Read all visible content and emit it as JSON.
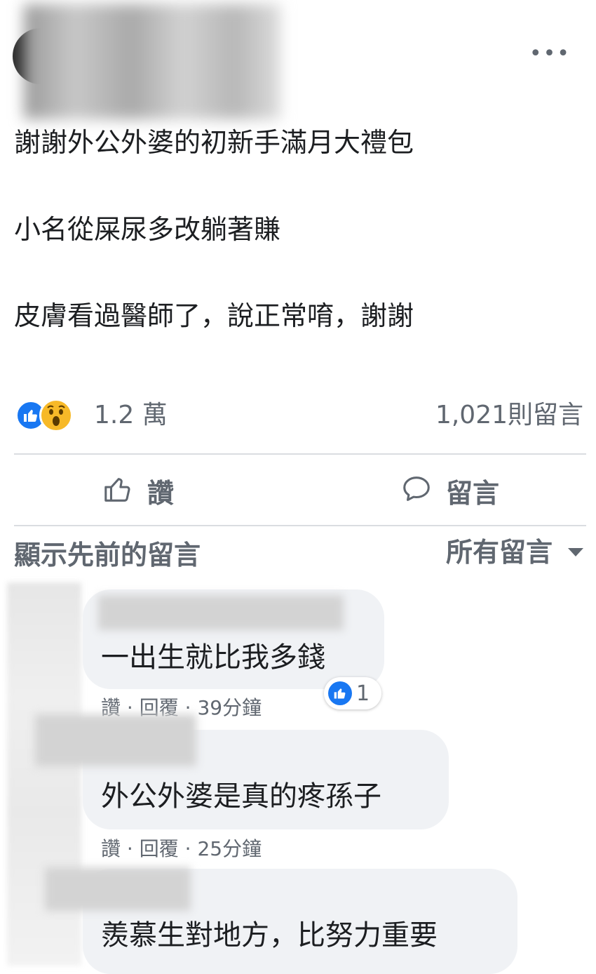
{
  "post": {
    "menu_icon": "more-horizontal-icon",
    "lines": [
      "謝謝外公外婆的初新手滿月大禮包",
      "小名從屎尿多改躺著賺",
      "皮膚看過醫師了，說正常唷，謝謝"
    ]
  },
  "stats": {
    "reaction_icons": [
      "like-icon",
      "wow-icon"
    ],
    "reaction_count": "1.2 萬",
    "comment_count": "1,021則留言"
  },
  "actions": {
    "like_label": "讚",
    "comment_label": "留言"
  },
  "comments_header": {
    "show_previous": "顯示先前的留言",
    "filter_label": "所有留言"
  },
  "comments": [
    {
      "text": "一出生就比我多錢",
      "like": "讚",
      "reply": "回覆",
      "time": "39分鐘",
      "reaction_count": "1"
    },
    {
      "text": "外公外婆是真的疼孫子",
      "like": "讚",
      "reply": "回覆",
      "time": "25分鐘"
    },
    {
      "text": "羨慕生對地方，比努力重要"
    }
  ],
  "colors": {
    "accent": "#1877f2",
    "secondary_text": "#606770",
    "bubble": "#f0f2f5"
  }
}
